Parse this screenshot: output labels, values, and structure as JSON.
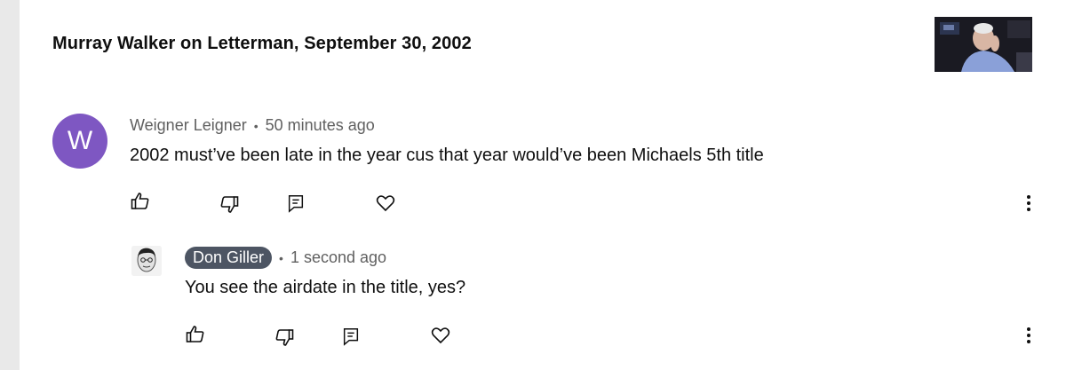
{
  "video": {
    "title": "Murray Walker on Letterman, September 30, 2002",
    "thumbnail_icon": "video-thumbnail"
  },
  "comments": [
    {
      "avatar_letter": "W",
      "avatar_color": "#7e57c2",
      "author": "Weigner Leigner",
      "separator": "•",
      "time": "50 minutes ago",
      "text": "2002 must’ve been late in the year cus that year would’ve been Michaels 5th title"
    }
  ],
  "replies": [
    {
      "author": "Don Giller",
      "author_badge_color": "#4d5563",
      "separator": "•",
      "time": "1 second ago",
      "text": "You see the airdate in the title, yes?"
    }
  ],
  "actions": {
    "icons": [
      "thumbs-up-icon",
      "thumbs-down-icon",
      "reply-icon",
      "heart-icon",
      "more-vert-icon"
    ]
  }
}
